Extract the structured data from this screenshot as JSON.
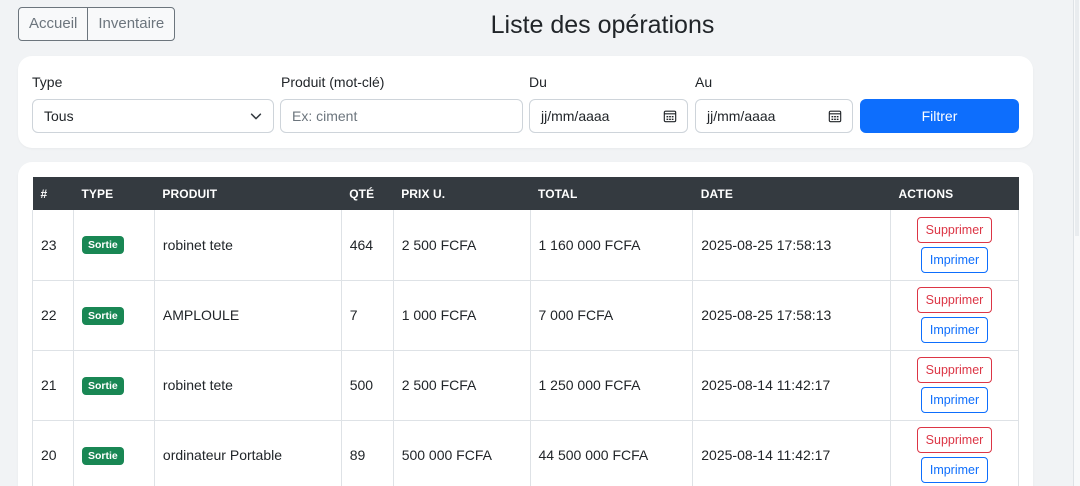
{
  "nav": {
    "home": "Accueil",
    "inventory": "Inventaire"
  },
  "page_title": "Liste des opérations",
  "filters": {
    "type_label": "Type",
    "type_value": "Tous",
    "product_label": "Produit (mot-clé)",
    "product_placeholder": "Ex: ciment",
    "from_label": "Du",
    "from_placeholder": "jj/mm/aaaa",
    "to_label": "Au",
    "to_placeholder": "jj/mm/aaaa",
    "filter_button": "Filtrer"
  },
  "table": {
    "headers": [
      "#",
      "TYPE",
      "PRODUIT",
      "QTÉ",
      "PRIX U.",
      "TOTAL",
      "DATE",
      "ACTIONS"
    ],
    "delete_label": "Supprimer",
    "print_label": "Imprimer",
    "rows": [
      {
        "id": "23",
        "type": "Sortie",
        "product": "robinet tete",
        "qty": "464",
        "unit_price": "2 500 FCFA",
        "total": "1 160 000 FCFA",
        "date": "2025-08-25 17:58:13"
      },
      {
        "id": "22",
        "type": "Sortie",
        "product": "AMPLOULE",
        "qty": "7",
        "unit_price": "1 000 FCFA",
        "total": "7 000 FCFA",
        "date": "2025-08-25 17:58:13"
      },
      {
        "id": "21",
        "type": "Sortie",
        "product": "robinet tete",
        "qty": "500",
        "unit_price": "2 500 FCFA",
        "total": "1 250 000 FCFA",
        "date": "2025-08-14 11:42:17"
      },
      {
        "id": "20",
        "type": "Sortie",
        "product": "ordinateur Portable",
        "qty": "89",
        "unit_price": "500 000 FCFA",
        "total": "44 500 000 FCFA",
        "date": "2025-08-14 11:42:17"
      }
    ]
  },
  "colors": {
    "primary": "#0d6efd",
    "danger": "#dc3545",
    "success": "#198754",
    "header_dark": "#343a40"
  }
}
